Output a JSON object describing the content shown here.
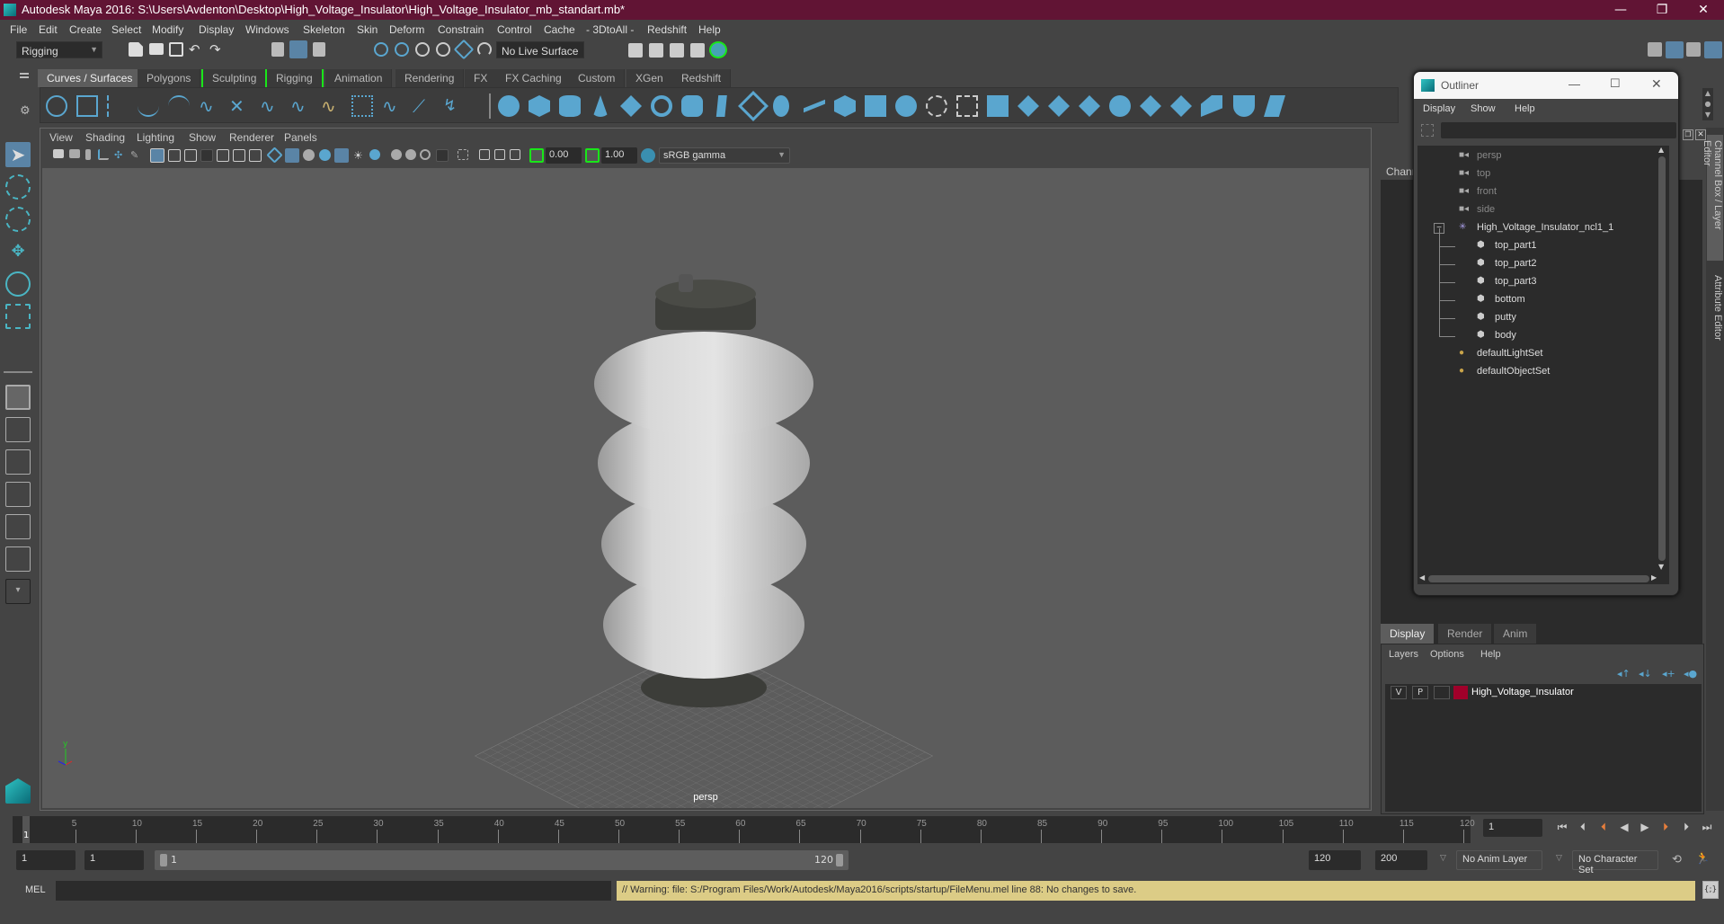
{
  "window": {
    "title": "Autodesk Maya 2016: S:\\Users\\Avdenton\\Desktop\\High_Voltage_Insulator\\High_Voltage_Insulator_mb_standart.mb*",
    "controls": {
      "minimize": "—",
      "restore": "❐",
      "close": "✕"
    }
  },
  "menubar": [
    "File",
    "Edit",
    "Create",
    "Select",
    "Modify",
    "Display",
    "Windows",
    "Skeleton",
    "Skin",
    "Deform",
    "Constrain",
    "Control",
    "Cache",
    "- 3DtoAll -",
    "Redshift",
    "Help"
  ],
  "statusline": {
    "menuset": "Rigging",
    "live_surface": "No Live Surface"
  },
  "shelf": {
    "tabs": [
      "Curves / Surfaces",
      "Polygons",
      "Sculpting",
      "Rigging",
      "Animation",
      "Rendering",
      "FX",
      "FX Caching",
      "Custom",
      "XGen",
      "Redshift"
    ],
    "active_tab": "Curves / Surfaces"
  },
  "viewport": {
    "menu": [
      "View",
      "Shading",
      "Lighting",
      "Show",
      "Renderer",
      "Panels"
    ],
    "exposure": "0.00",
    "gamma": "1.00",
    "color_space": "sRGB gamma",
    "camera_label": "persp",
    "axis": {
      "y": "y",
      "x": "x",
      "z": "z"
    }
  },
  "right_panel": {
    "channel_label": "Chann",
    "vertical_tabs": [
      "Channel Box / Layer Editor",
      "Attribute Editor"
    ]
  },
  "outliner": {
    "title": "Outliner",
    "menu": [
      "Display",
      "Show",
      "Help"
    ],
    "filter_placeholder": "",
    "items": [
      {
        "label": "persp",
        "type": "camera",
        "depth": 0
      },
      {
        "label": "top",
        "type": "camera",
        "depth": 0
      },
      {
        "label": "front",
        "type": "camera",
        "depth": 0
      },
      {
        "label": "side",
        "type": "camera",
        "depth": 0
      },
      {
        "label": "High_Voltage_Insulator_ncl1_1",
        "type": "group",
        "depth": 0,
        "expanded": true
      },
      {
        "label": "top_part1",
        "type": "mesh",
        "depth": 1
      },
      {
        "label": "top_part2",
        "type": "mesh",
        "depth": 1
      },
      {
        "label": "top_part3",
        "type": "mesh",
        "depth": 1
      },
      {
        "label": "bottom",
        "type": "mesh",
        "depth": 1
      },
      {
        "label": "putty",
        "type": "mesh",
        "depth": 1
      },
      {
        "label": "body",
        "type": "mesh",
        "depth": 1
      },
      {
        "label": "defaultLightSet",
        "type": "set",
        "depth": 0
      },
      {
        "label": "defaultObjectSet",
        "type": "set",
        "depth": 0
      }
    ]
  },
  "layer_editor": {
    "tabs": [
      "Display",
      "Render",
      "Anim"
    ],
    "active_tab": "Display",
    "menu": [
      "Layers",
      "Options",
      "Help"
    ],
    "layers": [
      {
        "v": "V",
        "p": "P",
        "name": "High_Voltage_Insulator",
        "color": "#a0002a"
      }
    ]
  },
  "timeline": {
    "start": 1,
    "end": 120,
    "current_frame": "1",
    "tick_labels": [
      "5",
      "10",
      "15",
      "20",
      "25",
      "30",
      "35",
      "40",
      "45",
      "50",
      "55",
      "60",
      "65",
      "70",
      "75",
      "80",
      "85",
      "90",
      "95",
      "100",
      "105",
      "110",
      "115",
      "120"
    ],
    "current_marker": "1"
  },
  "range": {
    "start_field": "1",
    "playback_start": "1",
    "range_start_label": "1",
    "range_end_label": "120",
    "playback_end": "120",
    "end_field": "200",
    "anim_layer": "No Anim Layer",
    "character_set": "No Character Set"
  },
  "command_line": {
    "label": "MEL",
    "input": "",
    "output": "// Warning: file: S:/Program Files/Work/Autodesk/Maya2016/scripts/startup/FileMenu.mel line 88: No changes to save."
  },
  "colors": {
    "titlebar": "#611434",
    "accent_blue": "#5aa6cf",
    "warning_bg": "#dccc86",
    "layer_color": "#a0002a"
  }
}
